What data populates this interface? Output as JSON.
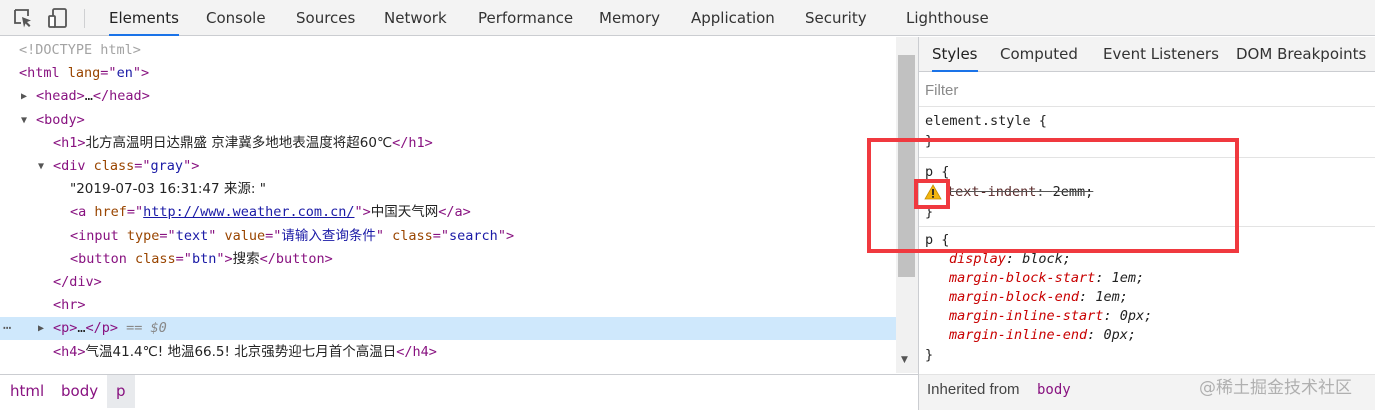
{
  "toolbar": {
    "tabs": [
      {
        "label": "Elements",
        "active": true
      },
      {
        "label": "Console"
      },
      {
        "label": "Sources"
      },
      {
        "label": "Network"
      },
      {
        "label": "Performance"
      },
      {
        "label": "Memory"
      },
      {
        "label": "Application"
      },
      {
        "label": "Security"
      },
      {
        "label": "Lighthouse"
      }
    ],
    "icons": [
      "inspect-element-icon",
      "device-toolbar-icon"
    ]
  },
  "dom_tree": {
    "lines": [
      {
        "indent": 0,
        "toggle": "",
        "segments": [
          [
            "doctype",
            "<!DOCTYPE html>"
          ]
        ]
      },
      {
        "indent": 0,
        "toggle": "",
        "segments": [
          [
            "tag",
            "<html "
          ],
          [
            "attr",
            "lang"
          ],
          [
            "tag",
            "=\""
          ],
          [
            "val",
            "en"
          ],
          [
            "tag",
            "\">"
          ]
        ]
      },
      {
        "indent": 1,
        "toggle": "collapsed",
        "segments": [
          [
            "tag",
            "<head>"
          ],
          [
            "ellip",
            "…"
          ],
          [
            "tag",
            "</head>"
          ]
        ]
      },
      {
        "indent": 1,
        "toggle": "expanded",
        "segments": [
          [
            "tag",
            "<body>"
          ]
        ]
      },
      {
        "indent": 2,
        "toggle": "",
        "segments": [
          [
            "tag",
            "<h1>"
          ],
          [
            "text",
            "北方高温明日达鼎盛 京津冀多地地表温度将超60℃"
          ],
          [
            "tag",
            "</h1>"
          ]
        ]
      },
      {
        "indent": 2,
        "toggle": "expanded",
        "segments": [
          [
            "tag",
            "<div "
          ],
          [
            "attr",
            "class"
          ],
          [
            "tag",
            "=\""
          ],
          [
            "val",
            "gray"
          ],
          [
            "tag",
            "\">"
          ]
        ]
      },
      {
        "indent": 3,
        "toggle": "",
        "segments": [
          [
            "text",
            "\"2019-07-03 16:31:47 来源: \""
          ]
        ]
      },
      {
        "indent": 3,
        "toggle": "",
        "segments": [
          [
            "tag",
            "<a "
          ],
          [
            "attr",
            "href"
          ],
          [
            "tag",
            "=\""
          ],
          [
            "link",
            "http://www.weather.com.cn/"
          ],
          [
            "tag",
            "\">"
          ],
          [
            "text",
            "中国天气网"
          ],
          [
            "tag",
            "</a>"
          ]
        ]
      },
      {
        "indent": 3,
        "toggle": "",
        "segments": [
          [
            "tag",
            "<input "
          ],
          [
            "attr",
            "type"
          ],
          [
            "tag",
            "=\""
          ],
          [
            "val",
            "text"
          ],
          [
            "tag",
            "\" "
          ],
          [
            "attr",
            "value"
          ],
          [
            "tag",
            "=\""
          ],
          [
            "val",
            "请输入查询条件"
          ],
          [
            "tag",
            "\" "
          ],
          [
            "attr",
            "class"
          ],
          [
            "tag",
            "=\""
          ],
          [
            "val",
            "search"
          ],
          [
            "tag",
            "\">"
          ]
        ]
      },
      {
        "indent": 3,
        "toggle": "",
        "segments": [
          [
            "tag",
            "<button "
          ],
          [
            "attr",
            "class"
          ],
          [
            "tag",
            "=\""
          ],
          [
            "val",
            "btn"
          ],
          [
            "tag",
            "\">"
          ],
          [
            "text",
            "搜索"
          ],
          [
            "tag",
            "</button>"
          ]
        ]
      },
      {
        "indent": 2,
        "toggle": "",
        "segments": [
          [
            "tag",
            "</div>"
          ]
        ]
      },
      {
        "indent": 2,
        "toggle": "",
        "segments": [
          [
            "tag",
            "<hr>"
          ]
        ]
      },
      {
        "indent": 2,
        "toggle": "collapsed",
        "selected": true,
        "segments": [
          [
            "tag",
            "<p>"
          ],
          [
            "ellip",
            "…"
          ],
          [
            "tag",
            "</p>"
          ],
          [
            "eq",
            " == $0"
          ]
        ]
      },
      {
        "indent": 2,
        "toggle": "",
        "segments": [
          [
            "tag",
            "<h4>"
          ],
          [
            "text",
            "气温41.4℃! 地温66.5! 北京强势迎七月首个高温日"
          ],
          [
            "tag",
            "</h4>"
          ]
        ]
      }
    ],
    "selected_dots": "⋯"
  },
  "breadcrumb": [
    {
      "label": "html"
    },
    {
      "label": "body"
    },
    {
      "label": "p",
      "active": true
    }
  ],
  "styles_pane": {
    "tabs": [
      {
        "label": "Styles",
        "active": true
      },
      {
        "label": "Computed"
      },
      {
        "label": "Event Listeners"
      },
      {
        "label": "DOM Breakpoints"
      }
    ],
    "filter_placeholder": "Filter",
    "element_style": {
      "selector": "element.style {",
      "close": "}"
    },
    "rule_p_user": {
      "selector": "p {",
      "property": "text-indent",
      "value": "2emm;",
      "invalid": true,
      "close": "}"
    },
    "rule_p_ua": {
      "selector": "p {",
      "declarations": [
        {
          "property": "display",
          "value": "block;"
        },
        {
          "property": "margin-block-start",
          "value": "1em;"
        },
        {
          "property": "margin-block-end",
          "value": "1em;"
        },
        {
          "property": "margin-inline-start",
          "value": "0px;"
        },
        {
          "property": "margin-inline-end",
          "value": "0px;"
        }
      ],
      "close": "}"
    },
    "inherited_label": "Inherited from",
    "inherited_tag": "body",
    "watermark": "@稀土掘金技术社区"
  },
  "colors": {
    "tag": "#881280",
    "attr": "#994500",
    "value": "#1a1aa6",
    "css_property": "#c80000",
    "selected_row": "#cfe8fc",
    "annotation": "#f0393f",
    "active_tab_underline": "#1a73e8"
  }
}
